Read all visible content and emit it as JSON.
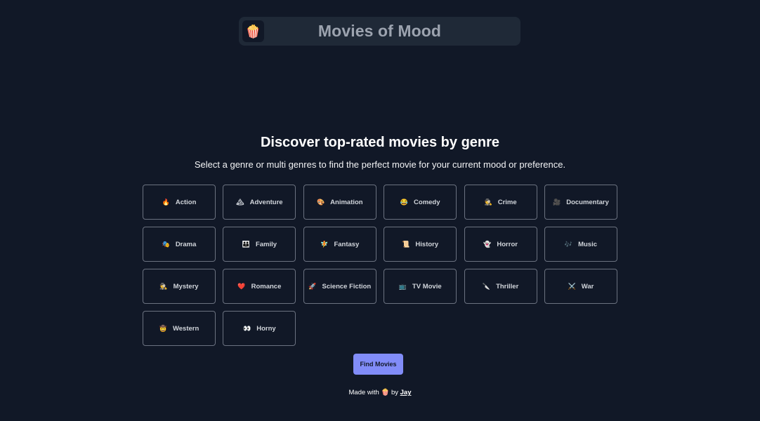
{
  "header": {
    "logo_emoji": "🍿",
    "title": "Movies of Mood"
  },
  "hero": {
    "title": "Discover top-rated movies by genre",
    "subtitle": "Select a genre or multi genres to find the perfect movie for your current mood or preference."
  },
  "genres": [
    {
      "emoji": "🔥",
      "label": "Action",
      "icon": "fire-icon"
    },
    {
      "emoji": "🏔",
      "label": "Adventure",
      "icon": "mountain-icon"
    },
    {
      "emoji": "🎨",
      "label": "Animation",
      "icon": "palette-icon"
    },
    {
      "emoji": "😂",
      "label": "Comedy",
      "icon": "laughing-face-icon"
    },
    {
      "emoji": "🕵",
      "label": "Crime",
      "icon": "detective-icon"
    },
    {
      "emoji": "🎥",
      "label": "Documentary",
      "icon": "movie-camera-icon"
    },
    {
      "emoji": "🎭",
      "label": "Drama",
      "icon": "theater-masks-icon"
    },
    {
      "emoji": "👪",
      "label": "Family",
      "icon": "family-icon"
    },
    {
      "emoji": "🧚",
      "label": "Fantasy",
      "icon": "fairy-icon"
    },
    {
      "emoji": "📜",
      "label": "History",
      "icon": "scroll-icon"
    },
    {
      "emoji": "👻",
      "label": "Horror",
      "icon": "ghost-icon"
    },
    {
      "emoji": "🎶",
      "label": "Music",
      "icon": "music-notes-icon"
    },
    {
      "emoji": "🕵",
      "label": "Mystery",
      "icon": "detective-icon"
    },
    {
      "emoji": "❤️",
      "label": "Romance",
      "icon": "heart-icon"
    },
    {
      "emoji": "🚀",
      "label": "Science Fiction",
      "icon": "rocket-icon"
    },
    {
      "emoji": "📺",
      "label": "TV Movie",
      "icon": "television-icon"
    },
    {
      "emoji": "🔪",
      "label": "Thriller",
      "icon": "knife-icon"
    },
    {
      "emoji": "⚔️",
      "label": "War",
      "icon": "crossed-swords-icon"
    },
    {
      "emoji": "🤠",
      "label": "Western",
      "icon": "cowboy-icon"
    },
    {
      "emoji": "👀",
      "label": "Horny",
      "icon": "eyes-icon"
    }
  ],
  "actions": {
    "find_label": "Find Movies"
  },
  "footer": {
    "made_with": "Made with",
    "emoji": "🍿",
    "by": "by",
    "author": "Jay"
  },
  "colors": {
    "background": "#111827",
    "header_bg": "#1f2937",
    "accent": "#818cf8",
    "border": "#6b7280"
  }
}
